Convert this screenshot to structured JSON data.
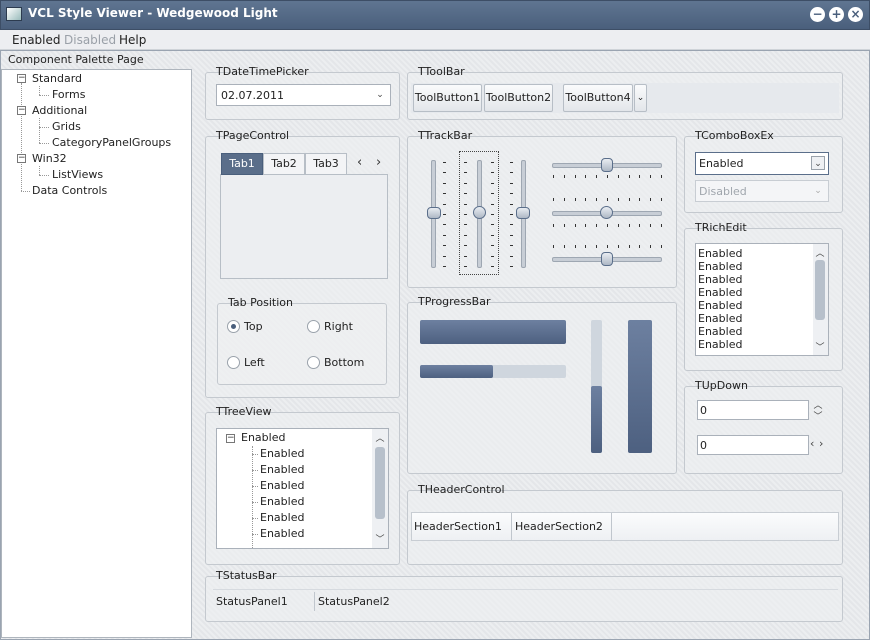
{
  "window": {
    "title": "VCL Style Viewer - Wedgewood Light"
  },
  "menu": {
    "items": [
      "Enabled",
      "Disabled",
      "Help"
    ]
  },
  "palette": {
    "label": "Component Palette Page",
    "nodes": [
      {
        "label": "Standard",
        "box": "−"
      },
      {
        "label": "Forms"
      },
      {
        "label": "Additional",
        "box": "−"
      },
      {
        "label": "Grids"
      },
      {
        "label": "CategoryPanelGroups"
      },
      {
        "label": "Win32",
        "box": "−"
      },
      {
        "label": "ListViews"
      },
      {
        "label": "Data Controls"
      }
    ]
  },
  "datetimepicker": {
    "title": "TDateTimePicker",
    "value": "02.07.2011"
  },
  "toolbar": {
    "title": "TToolBar",
    "buttons": [
      "ToolButton1",
      "ToolButton2",
      "ToolButton4"
    ]
  },
  "pagecontrol": {
    "title": "TPageControl",
    "tabs": [
      "Tab1",
      "Tab2",
      "Tab3"
    ],
    "active_tab": "Tab1"
  },
  "tabposition": {
    "title": "Tab Position",
    "options": [
      "Top",
      "Right",
      "Left",
      "Bottom"
    ],
    "selected": "Top"
  },
  "trackbar": {
    "title": "TTrackBar"
  },
  "comboboxex": {
    "title": "TComboBoxEx",
    "enabled_value": "Enabled",
    "disabled_value": "Disabled"
  },
  "richedit": {
    "title": "TRichEdit",
    "lines": [
      "Enabled",
      "Enabled",
      "Enabled",
      "Enabled",
      "Enabled",
      "Enabled",
      "Enabled",
      "Enabled"
    ]
  },
  "progressbar": {
    "title": "TProgressBar",
    "bars": [
      {
        "orientation": "horizontal",
        "progress": 1.0
      },
      {
        "orientation": "horizontal",
        "progress": 0.5
      },
      {
        "orientation": "vertical",
        "progress": 0.5
      },
      {
        "orientation": "vertical",
        "progress": 1.0
      }
    ]
  },
  "updown": {
    "title": "TUpDown",
    "values": [
      "0",
      "0"
    ]
  },
  "treeview": {
    "title": "TTreeView",
    "root": "Enabled",
    "children": [
      "Enabled",
      "Enabled",
      "Enabled",
      "Enabled",
      "Enabled",
      "Enabled"
    ]
  },
  "headercontrol": {
    "title": "THeaderControl",
    "sections": [
      "HeaderSection1",
      "HeaderSection2"
    ]
  },
  "statusbar": {
    "title": "TStatusBar",
    "panels": [
      "StatusPanel1",
      "StatusPanel2"
    ]
  },
  "colors": {
    "accent": "#4a5f7c",
    "titlebar": "#5f7591"
  }
}
